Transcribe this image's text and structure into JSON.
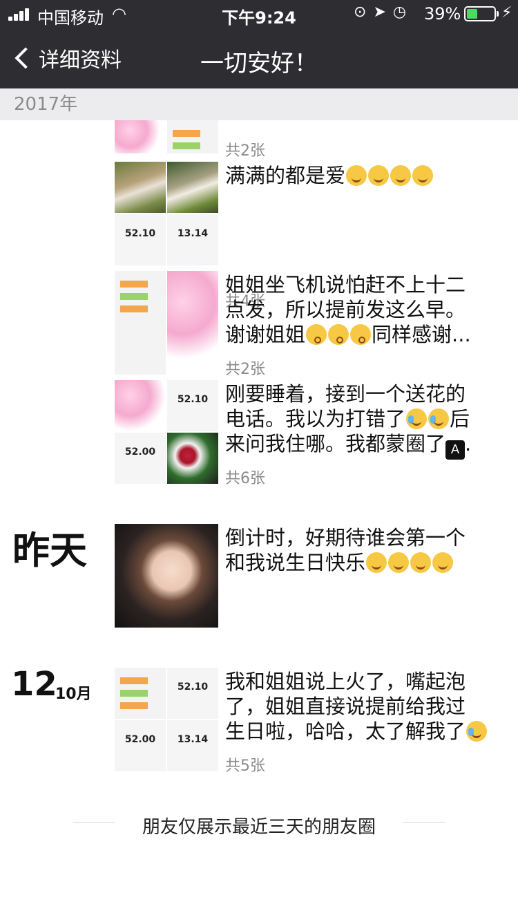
{
  "status_bar": {
    "carrier": "中国移动",
    "time": "下午9:24",
    "battery_percent": "39%",
    "battery_level": 0.39
  },
  "nav": {
    "back_label": "详细资料",
    "title": "一切安好！"
  },
  "year_header": "2017年",
  "posts": [
    {
      "count": "共2张"
    },
    {
      "text": "满满的都是爱",
      "emoji_count": 4,
      "count": "共4张"
    },
    {
      "text_lines": [
        "姐姐坐飞机说怕赶不上十二",
        "点发，所以提前发这么早。",
        "谢谢姐姐",
        "同样感谢..."
      ],
      "count": "共2张"
    },
    {
      "text_lines": [
        "刚要睡着，接到一个送花的",
        "电话。我以为打错了",
        "后",
        "来问我住哪。我都蒙圈了",
        "."
      ],
      "count": "共6张"
    },
    {
      "date": "昨天",
      "text_lines": [
        "倒计时，好期待谁会第一个",
        "和我说生日快乐"
      ]
    },
    {
      "date_day": "12",
      "date_month": "10月",
      "text_lines": [
        "我和姐姐说上火了，嘴起泡",
        "了，姐姐直接说提前给我过",
        "生日啦，哈哈，太了解我了"
      ],
      "count": "共5张"
    }
  ],
  "thumb_labels": [
    "52.10",
    "13.14",
    "52.10",
    "52.00",
    "52.10",
    "52.00",
    "13.14"
  ],
  "footer": "朋友仅展示最近三天的朋友圈"
}
